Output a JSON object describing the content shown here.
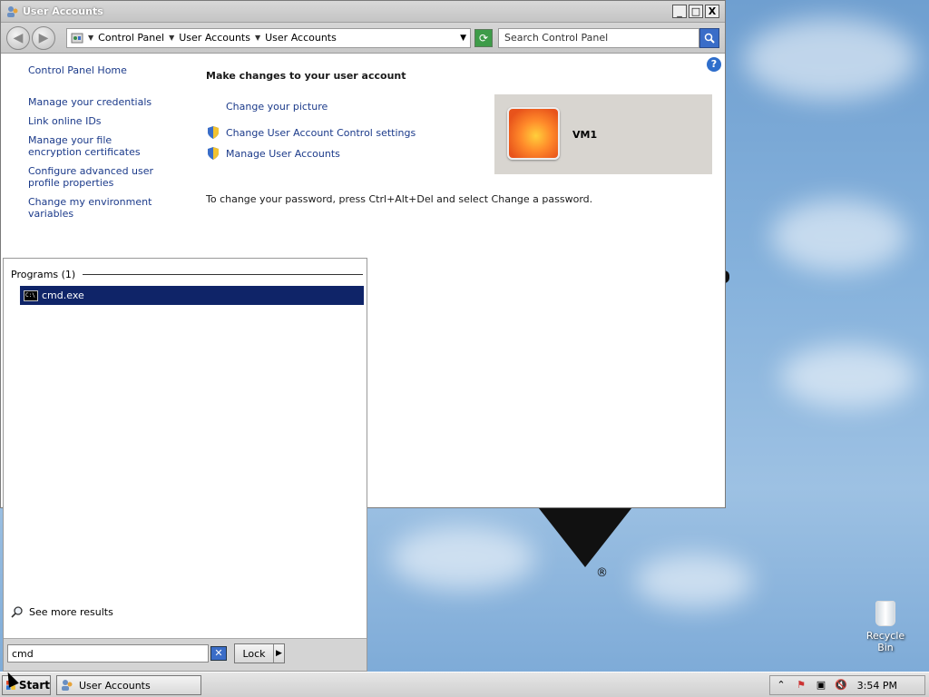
{
  "window": {
    "title": "User Accounts",
    "controls": {
      "minimize": "_",
      "maximize": "□",
      "close": "X"
    }
  },
  "address": {
    "crumbs": [
      "Control Panel",
      "User Accounts",
      "User Accounts"
    ],
    "search_placeholder": "Search Control Panel"
  },
  "leftnav": {
    "home": "Control Panel Home",
    "items": [
      "Manage your credentials",
      "Link online IDs",
      "Manage your file encryption certificates",
      "Configure advanced user profile properties",
      "Change my environment variables"
    ]
  },
  "main": {
    "heading": "Make changes to your user account",
    "links": [
      "Change your picture",
      "Change User Account Control settings",
      "Manage User Accounts"
    ],
    "username": "VM1",
    "info": "To change your password, press Ctrl+Alt+Del and select Change a password."
  },
  "startmenu": {
    "programs_header": "Programs (1)",
    "result": "cmd.exe",
    "see_more": "See more results",
    "search_value": "cmd",
    "lock_label": "Lock"
  },
  "taskbar": {
    "start_label": "Start",
    "task_label": "User Accounts",
    "clock": "3:54 PM"
  },
  "desktop": {
    "recycle_bin": "Recycle Bin"
  },
  "colors": {
    "link": "#1b3a8a",
    "selection": "#0f2468",
    "desktop_sky": "#86b2dc"
  }
}
